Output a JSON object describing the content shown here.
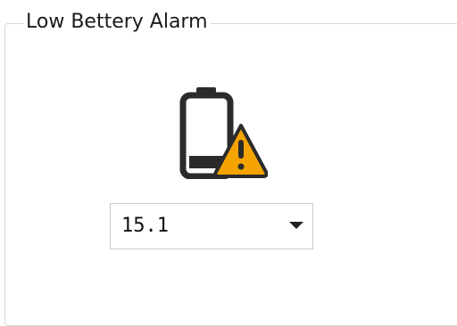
{
  "groupbox": {
    "title": "Low Bettery Alarm"
  },
  "icon": {
    "name": "low-battery-warning-icon"
  },
  "threshold_select": {
    "value": "15.1"
  }
}
